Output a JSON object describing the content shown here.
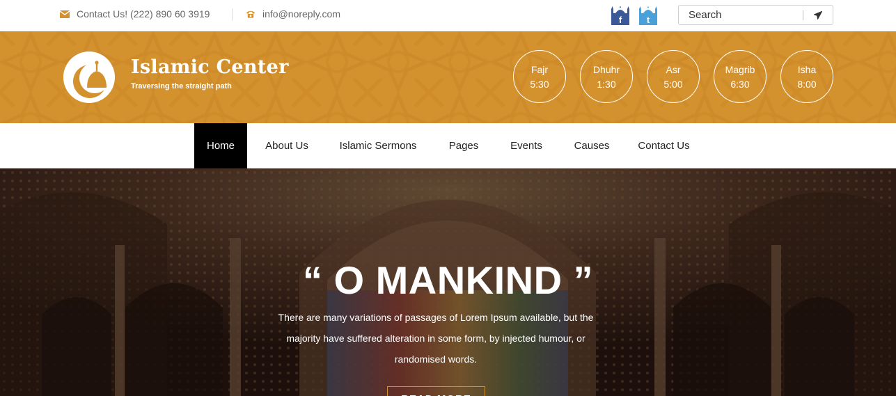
{
  "topbar": {
    "phone_text": "Contact Us! (222) 890 60 3919",
    "email_text": "info@noreply.com",
    "search_placeholder": "Search",
    "icons": {
      "phone": "envelope-icon",
      "email": "phone-icon",
      "facebook": "facebook-mosque-icon",
      "twitter": "twitter-mosque-icon",
      "send": "paper-plane-icon"
    }
  },
  "header": {
    "title": "Islamic Center",
    "tagline": "Traversing the straight path",
    "prayers": [
      {
        "name": "Fajr",
        "time": "5:30"
      },
      {
        "name": "Dhuhr",
        "time": "1:30"
      },
      {
        "name": "Asr",
        "time": "5:00"
      },
      {
        "name": "Magrib",
        "time": "6:30"
      },
      {
        "name": "Isha",
        "time": "8:00"
      }
    ]
  },
  "nav": {
    "items": [
      {
        "label": "Home",
        "active": true
      },
      {
        "label": "About Us"
      },
      {
        "label": "Islamic Sermons"
      },
      {
        "label": "Pages"
      },
      {
        "label": "Events"
      },
      {
        "label": "Causes"
      },
      {
        "label": "Contact Us"
      }
    ]
  },
  "hero": {
    "title": "“ O MANKIND ”",
    "text": "There are many variations of passages of Lorem Ipsum available, but the majority have suffered alteration in some form, by injected humour, or randomised words.",
    "button_label": "READ MORE"
  },
  "colors": {
    "accent": "#d4922f",
    "nav_active": "#000000",
    "text_muted": "#666666"
  }
}
